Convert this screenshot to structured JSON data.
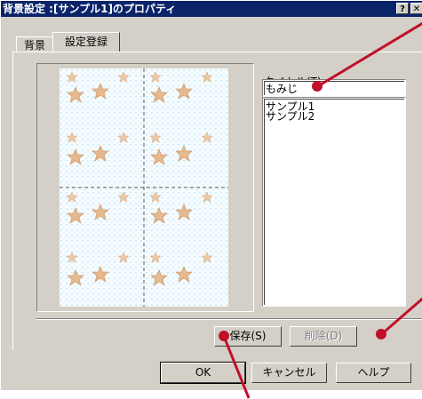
{
  "window": {
    "title": "背景設定 :[サンプル1]のプロパティ",
    "help_button": "?",
    "close_button": "✕"
  },
  "tabs": [
    {
      "label": "背景",
      "active": false
    },
    {
      "label": "設定登録",
      "active": true
    }
  ],
  "title_field": {
    "label": "タイトル(T):",
    "value": "もみじ"
  },
  "list": {
    "items": [
      "サンプル1",
      "サンプル2"
    ]
  },
  "actions": {
    "save": "保存(S)",
    "delete": "削除(D)"
  },
  "footer": {
    "ok": "OK",
    "cancel": "キャンセル",
    "help": "ヘルプ"
  },
  "colors": {
    "title_bar": "#0a246a",
    "dialog_face": "#d4d0c8",
    "callout": "#c0102a"
  }
}
